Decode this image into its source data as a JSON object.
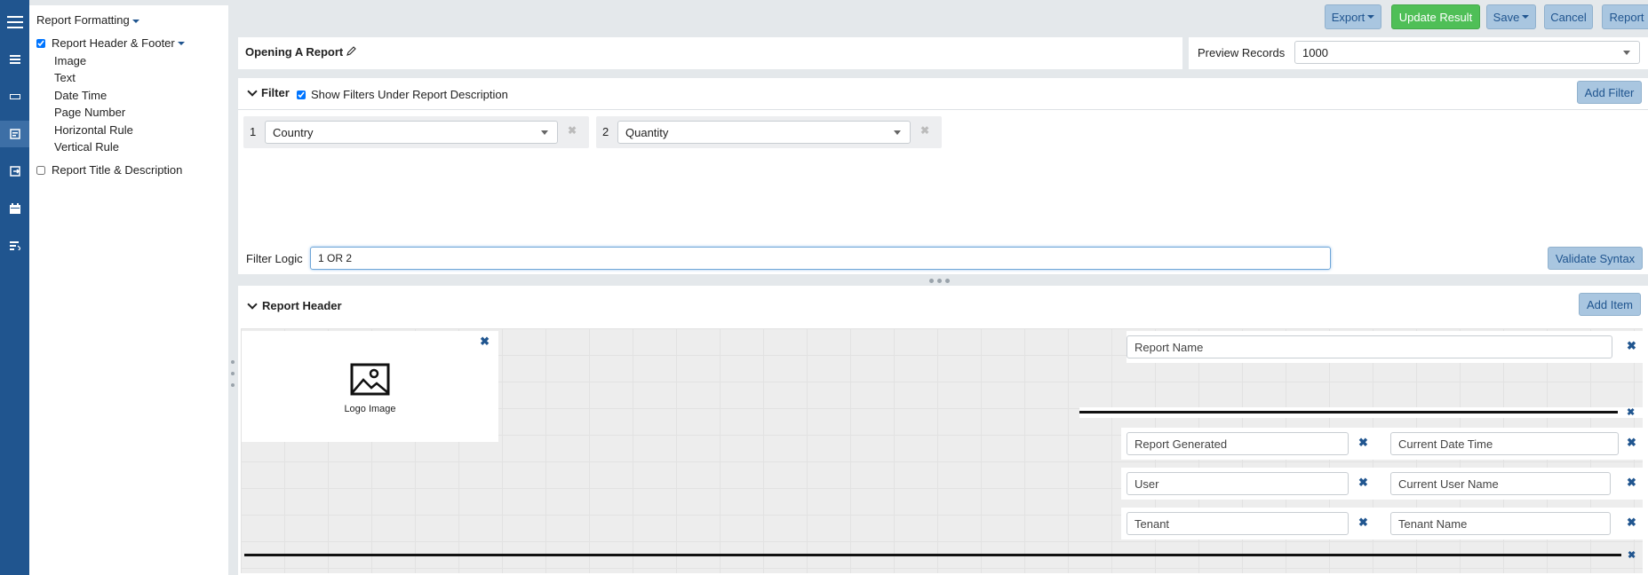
{
  "rail": {
    "icons": [
      "menu-icon",
      "list-icon",
      "minus-icon",
      "report-icon",
      "export-icon",
      "calendar-icon",
      "sort-list-icon"
    ]
  },
  "formatting": {
    "title": "Report Formatting",
    "header_footer_label": "Report Header & Footer",
    "header_footer_checked": true,
    "items": [
      "Image",
      "Text",
      "Date Time",
      "Page Number",
      "Horizontal Rule",
      "Vertical Rule"
    ],
    "title_desc_label": "Report Title & Description",
    "title_desc_checked": false
  },
  "toolbar": {
    "export_label": "Export",
    "update_label": "Update Result",
    "save_label": "Save",
    "cancel_label": "Cancel",
    "report_label": "Report"
  },
  "report": {
    "title": "Opening A Report",
    "preview_label": "Preview Records",
    "preview_value": "1000"
  },
  "filter": {
    "heading": "Filter",
    "show_under_label": "Show Filters Under Report Description",
    "show_under_checked": true,
    "add_label": "Add Filter",
    "filters": [
      {
        "num": "1",
        "field": "Country"
      },
      {
        "num": "2",
        "field": "Quantity"
      }
    ],
    "logic_label": "Filter Logic",
    "logic_value": "1 OR 2",
    "validate_label": "Validate Syntax"
  },
  "report_header": {
    "heading": "Report Header",
    "add_label": "Add Item",
    "logo_caption": "Logo Image",
    "report_name": "Report Name",
    "rows": [
      {
        "label": "Report Generated",
        "value": "Current Date Time"
      },
      {
        "label": "User",
        "value": "Current User Name"
      },
      {
        "label": "Tenant",
        "value": "Tenant Name"
      }
    ]
  },
  "colors": {
    "rail": "#20558f",
    "primary_button": "#a9c6e0",
    "success_button": "#4fbf57"
  }
}
